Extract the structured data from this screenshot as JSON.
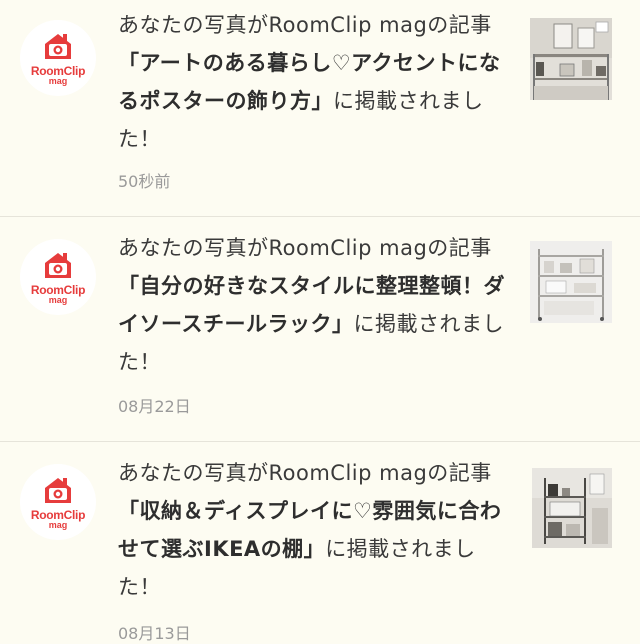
{
  "notifications": [
    {
      "logo": {
        "word": "RoomClip",
        "sub": "mag",
        "color": "#e63c3c",
        "icon": "camera-icon"
      },
      "prefix": "あなたの写真がRoomClip magの記事",
      "title": "「アートのある暮らし♡アクセントになるポスターの飾り方」",
      "suffix": "に掲載されました！",
      "time": "50秒前"
    },
    {
      "logo": {
        "word": "RoomClip",
        "sub": "mag",
        "color": "#e63c3c",
        "icon": "camera-icon"
      },
      "prefix": "あなたの写真がRoomClip magの記事",
      "title": "「自分の好きなスタイルに整理整頓！ダイソースチールラック」",
      "suffix": "に掲載されました！",
      "time": "08月22日"
    },
    {
      "logo": {
        "word": "RoomClip",
        "sub": "mag",
        "color": "#e63c3c",
        "icon": "camera-icon"
      },
      "prefix": "あなたの写真がRoomClip magの記事",
      "title": "「収納＆ディスプレイに♡雰囲気に合わせて選ぶIKEAの棚」",
      "suffix": "に掲載されました！",
      "time": "08月13日"
    }
  ]
}
